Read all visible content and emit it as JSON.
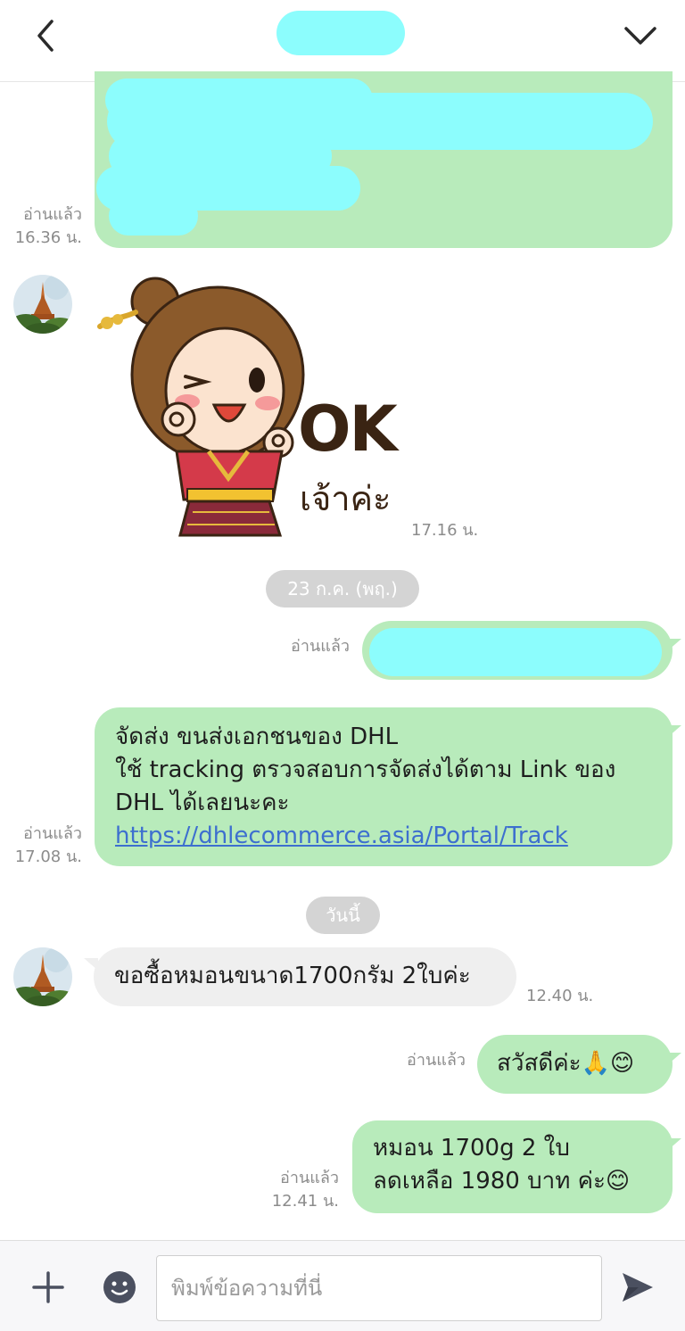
{
  "header": {
    "title": "",
    "back_icon": "chevron-left-icon",
    "menu_icon": "chevron-down-icon"
  },
  "messages": {
    "m1": {
      "read": "อ่านแล้ว",
      "time": "16.36 น."
    },
    "sticker": {
      "text_ok": "OK",
      "text_sub": "เจ้าค่ะ",
      "time": "17.16 น."
    },
    "date1": "23 ก.ค. (พฤ.)",
    "m2": {
      "read": "อ่านแล้ว"
    },
    "m3": {
      "line1": "จัดส่ง ขนส่งเอกชนของ DHL",
      "line2": "ใช้ tracking ตรวจสอบการจัดส่งได้ตาม Link ของ",
      "line3": "DHL ได้เลยนะคะ",
      "link": "https://dhlecommerce.asia/Portal/Track",
      "read": "อ่านแล้ว",
      "time": "17.08 น."
    },
    "date2": "วันนี้",
    "m4": {
      "text": "ขอซื้อหมอนขนาด1700กรัม 2ใบค่ะ",
      "time": "12.40 น."
    },
    "m5": {
      "text": "สวัสดีค่ะ🙏😊",
      "read": "อ่านแล้ว"
    },
    "m6": {
      "line1": "หมอน 1700g 2 ใบ",
      "line2": "ลดเหลือ 1980 บาท ค่ะ😊",
      "read": "อ่านแล้ว",
      "time": "12.41 น."
    }
  },
  "input": {
    "placeholder": "พิมพ์ข้อความที่นี่",
    "plus_icon": "plus-icon",
    "emoji_icon": "emoji-icon",
    "send_icon": "send-icon"
  },
  "colors": {
    "outgoing": "#b8ebbb",
    "incoming": "#efefef",
    "redaction": "#8cfdfd",
    "link": "#3d6fcf"
  }
}
